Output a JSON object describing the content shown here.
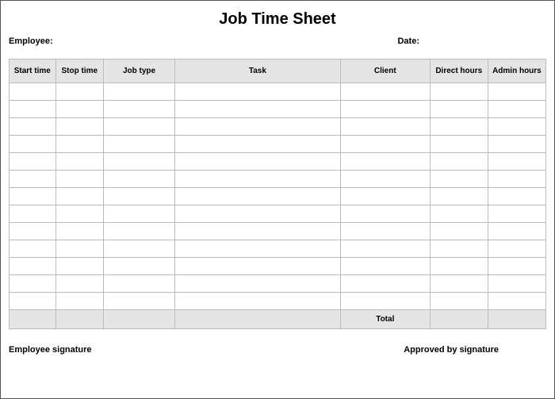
{
  "title": "Job Time Sheet",
  "meta": {
    "employee_label": "Employee:",
    "date_label": "Date:"
  },
  "columns": {
    "start_time": "Start time",
    "stop_time": "Stop time",
    "job_type": "Job type",
    "task": "Task",
    "client": "Client",
    "direct_hours": "Direct hours",
    "admin_hours": "Admin hours"
  },
  "total_label": "Total",
  "signatures": {
    "employee": "Employee signature",
    "approved": "Approved by signature"
  },
  "row_count": 13
}
